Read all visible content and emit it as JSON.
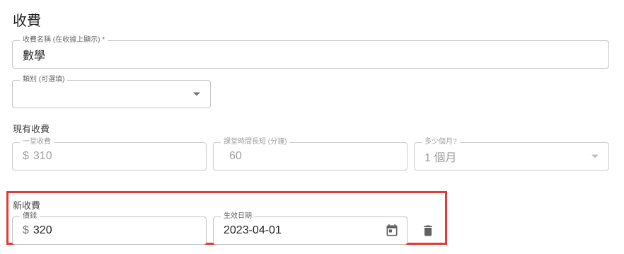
{
  "section": {
    "title": "收費"
  },
  "fee_name": {
    "label": "收費名稱 (在收據上顯示) *",
    "value": "數學"
  },
  "category": {
    "label": "類別 (可選填)",
    "value": ""
  },
  "current_fee": {
    "title": "現有收費",
    "lesson_fee": {
      "label": "一堂收費",
      "prefix": "$",
      "value": "310"
    },
    "duration": {
      "label": "課堂時間長短 (分鐘)",
      "value": "60"
    },
    "months": {
      "label": "多少個月?",
      "value": "1 個月"
    }
  },
  "new_fee": {
    "title": "新收費",
    "price": {
      "label": "價錢",
      "prefix": "$",
      "value": "320"
    },
    "effective_date": {
      "label": "生效日期",
      "value": "2023-04-01"
    }
  },
  "colors": {
    "highlight": "#e53935",
    "icon": "#616161"
  },
  "icons": {
    "calendar": "calendar-icon",
    "delete": "trash-icon",
    "dropdown": "chevron-down-icon"
  }
}
